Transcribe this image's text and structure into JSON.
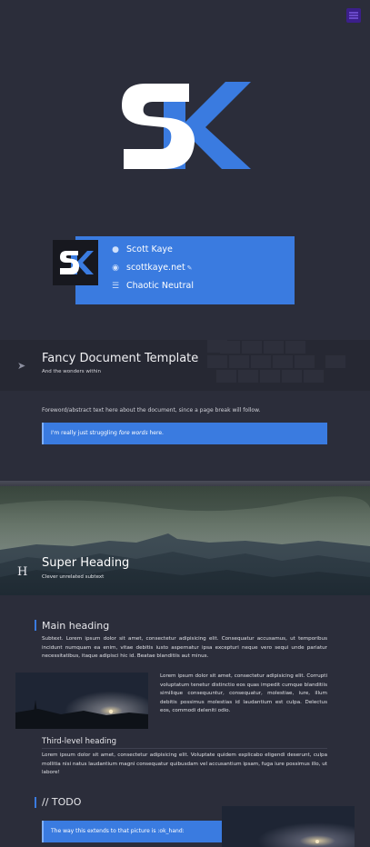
{
  "profile": {
    "name": "Scott Kaye",
    "website": "scottkaye.net",
    "alignment": "Chaotic Neutral",
    "name_icon": "user-icon",
    "website_icon": "globe-icon",
    "alignment_icon": "list-icon"
  },
  "band": {
    "title": "Fancy Document Template",
    "subtitle": "And the wonders within",
    "icon": "rocket-icon"
  },
  "foreword": {
    "text": "Foreword/abstract text here about the document, since a page break will follow.",
    "callout_prefix": "I'm really just struggling ",
    "callout_em": "fore words",
    "callout_suffix": " here."
  },
  "hero": {
    "title": "Super Heading",
    "subtitle": "Clever unrelated subtext",
    "icon_letter": "H"
  },
  "main": {
    "heading": "Main heading",
    "intro": "Subtext. Lorem ipsum dolor sit amet, consectetur adipisicing elit. Consequatur accusamus, ut temporibus incidunt numquam ea enim, vitae debitis iusto aspernatur ipsa excepturi neque vero sequi unde pariatur necessitatibus, itaque adipisci hic id. Beatae blanditiis aut minus.",
    "side_text": "Lorem ipsum dolor sit amet, consectetur adipisicing elit. Corrupti voluptatum tenetur distinctio eos quas impedit cumque blanditiis similique consequuntur, consequatur, molestiae, iure, illum debitis possimus molestias id laudantium est culpa. Delectus eos, commodi deleniti odio."
  },
  "third": {
    "heading": "Third-level heading",
    "text": "Lorem ipsum dolor sit amet, consectetur adipisicing elit. Voluptate quidem explicabo eligendi deserunt, culpa mollitia nisi natus laudantium magni consequatur quibusdam vel accusantium ipsam, fuga iure possimus illo, ut labore!"
  },
  "todo": {
    "heading": "// TODO",
    "callout": "The way this extends to that picture is :ok_hand:"
  },
  "colors": {
    "accent": "#3a7be0",
    "background": "#2b2d3a"
  }
}
